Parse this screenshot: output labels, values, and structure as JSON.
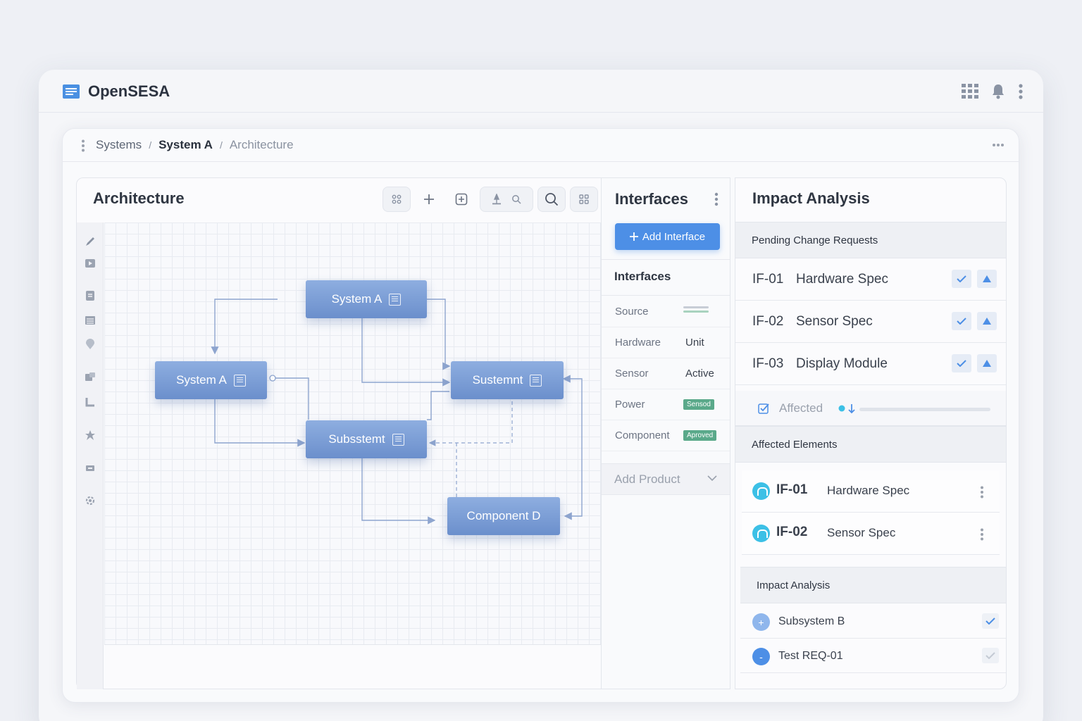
{
  "app": {
    "title": "OpenSESA"
  },
  "breadcrumb": {
    "items": [
      "Systems",
      "System A",
      "Architecture"
    ],
    "separator": "/"
  },
  "architecture": {
    "title": "Architecture",
    "nodes": [
      {
        "label": "System A"
      },
      {
        "label": "System A"
      },
      {
        "label": "Sustemnt"
      },
      {
        "label": "Subsstemt"
      },
      {
        "label": "Component D"
      }
    ]
  },
  "interfaces": {
    "title": "Interfaces",
    "add_button": "Add Interface",
    "subheading": "Interfaces",
    "rows": [
      {
        "key": "Source",
        "value": ""
      },
      {
        "key": "Hardware",
        "value": "Unit"
      },
      {
        "key": "Sensor",
        "value": "Active"
      },
      {
        "key": "Power",
        "tag": "Sensod"
      },
      {
        "key": "Component",
        "tag": "Aproved"
      }
    ],
    "add_product": "Add Product"
  },
  "impact": {
    "title": "Impact Analysis",
    "pending_heading": "Pending Change Requests",
    "pending": [
      {
        "id": "IF-01",
        "name": "Hardware Spec"
      },
      {
        "id": "IF-02",
        "name": "Sensor Spec"
      },
      {
        "id": "IF-03",
        "name": "Display Module"
      }
    ],
    "affected_label": "Affected",
    "affected_heading": "Affected Elements",
    "affected": [
      {
        "id": "IF-01",
        "name": "Hardware Spec"
      },
      {
        "id": "IF-02",
        "name": "Sensor Spec"
      }
    ],
    "analysis_heading": "Impact Analysis",
    "analysis": [
      {
        "name": "Subsystem B",
        "icon": "plus-icon",
        "checked": true
      },
      {
        "name": "Test REQ-01",
        "icon": "minus-icon",
        "checked": false
      }
    ]
  },
  "colors": {
    "accent": "#4d8fe6",
    "node": "#7b9ed8",
    "tag_green": "#5aa98a",
    "cyan": "#3cc0e6"
  }
}
